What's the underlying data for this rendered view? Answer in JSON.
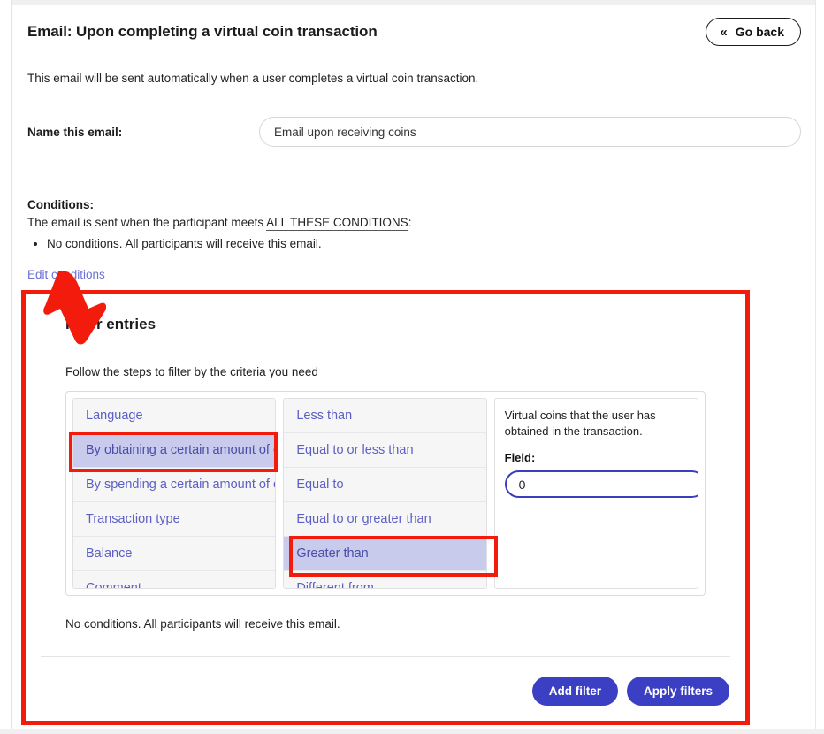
{
  "header": {
    "title": "Email: Upon completing a virtual coin transaction",
    "go_back_label": "Go back",
    "go_back_icon": "double-chevron-left-icon"
  },
  "intro": {
    "text": "This email will be sent automatically when a user completes a virtual coin transaction."
  },
  "name_row": {
    "label": "Name this email:",
    "value": "Email upon receiving coins"
  },
  "conditions": {
    "title": "Conditions:",
    "sentence_prefix": "The email is sent when the participant meets ",
    "sentence_emphasis": "ALL THESE CONDITIONS",
    "sentence_suffix": ":",
    "bullets": [
      "No conditions. All participants will receive this email."
    ],
    "edit_link": "Edit conditions"
  },
  "filter_panel": {
    "title": "Filter entries",
    "subtitle": "Follow the steps to filter by the criteria you need",
    "note": "No conditions. All participants will receive this email.",
    "criteria_options": [
      {
        "label": "Language",
        "selected": false
      },
      {
        "label": "By obtaining a certain amount of coins",
        "selected": true
      },
      {
        "label": "By spending a certain amount of coins",
        "selected": false
      },
      {
        "label": "Transaction type",
        "selected": false
      },
      {
        "label": "Balance",
        "selected": false
      },
      {
        "label": "Comment",
        "selected": false
      }
    ],
    "operator_options": [
      {
        "label": "Less than",
        "selected": false
      },
      {
        "label": "Equal to or less than",
        "selected": false
      },
      {
        "label": "Equal to",
        "selected": false
      },
      {
        "label": "Equal to or greater than",
        "selected": false
      },
      {
        "label": "Greater than",
        "selected": true
      },
      {
        "label": "Different from",
        "selected": false
      }
    ],
    "detail": {
      "description": "Virtual coins that the user has obtained in the transaction.",
      "field_label": "Field:",
      "field_value": "0"
    },
    "actions": {
      "add_filter": "Add filter",
      "apply_filters": "Apply filters"
    }
  },
  "annotations": {
    "outline_color": "#f21b0c",
    "arrow_color": "#f21b0c",
    "accent_color": "#3b3fc4",
    "selected_option_bg": "#c9cbec"
  }
}
